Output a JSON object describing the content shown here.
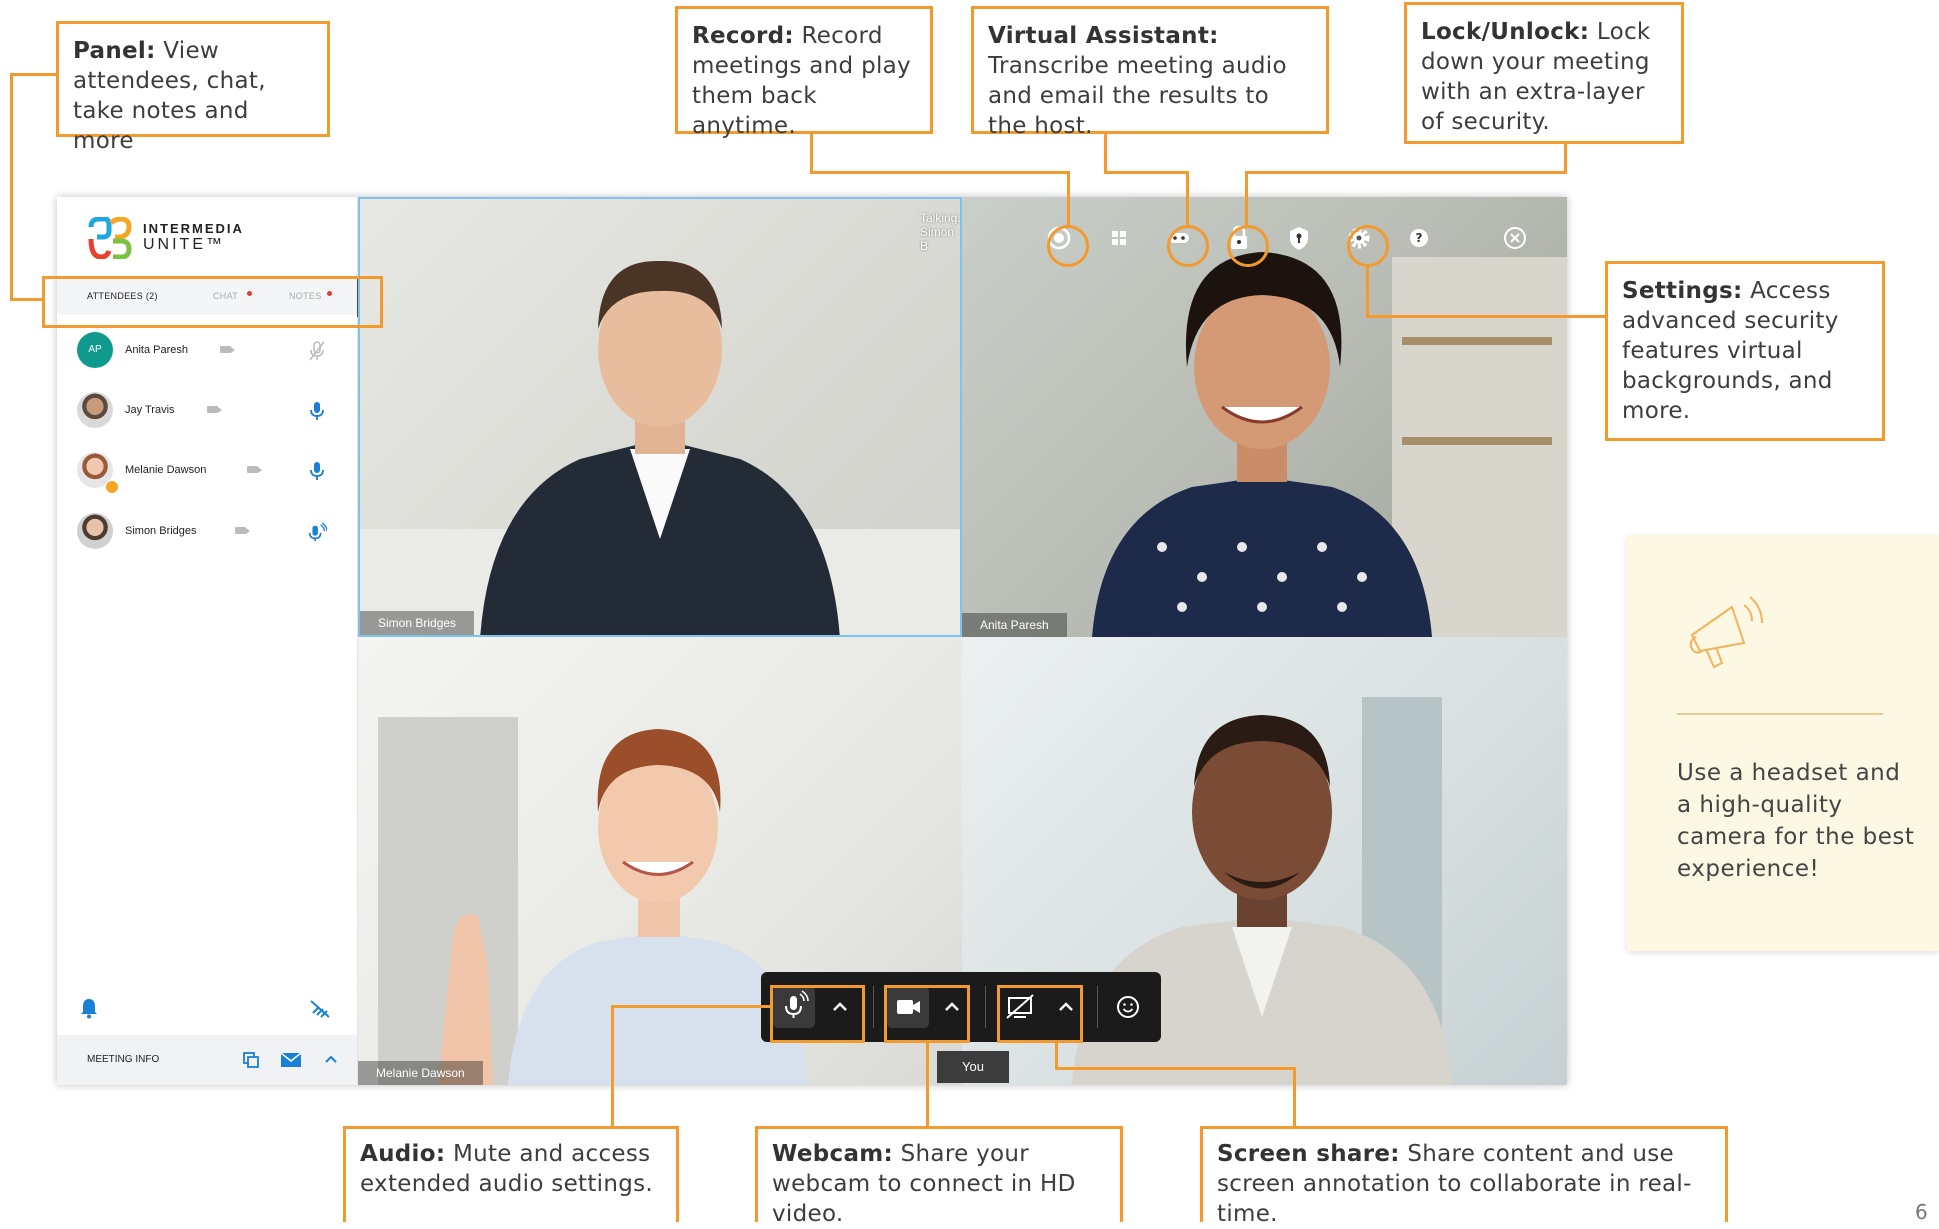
{
  "callouts": {
    "panel": {
      "title": "Panel:",
      "text": " View attendees, chat, take notes and more"
    },
    "record": {
      "title": "Record:",
      "text": " Record meetings and play them back anytime."
    },
    "assistant": {
      "title": "Virtual Assistant:",
      "text": " Transcribe meeting audio and email the results to the host."
    },
    "lock": {
      "title": "Lock/Unlock:",
      "text": " Lock down your meeting with an extra-layer of security."
    },
    "settings": {
      "title": "Settings:",
      "text": " Access advanced security features virtual backgrounds, and more."
    },
    "audio": {
      "title": "Audio:",
      "text": " Mute and access extended audio settings."
    },
    "webcam": {
      "title": "Webcam:",
      "text": " Share your webcam to connect in HD video."
    },
    "screenshare": {
      "title": "Screen share:",
      "text": " Share content and use screen annotation to collaborate in real-time."
    }
  },
  "app": {
    "logo_line1": "INTERMEDIA",
    "logo_line2": "UNITE™",
    "tabs": {
      "attendees": "ATTENDEES (2)",
      "chat": "CHAT",
      "notes": "NOTES"
    },
    "attendees": [
      {
        "initials": "AP",
        "name": "Anita Paresh"
      },
      {
        "name": "Jay Travis"
      },
      {
        "name": "Melanie Dawson"
      },
      {
        "name": "Simon Bridges"
      }
    ],
    "meeting_info": "MEETING INFO",
    "talking": "Talking: Simon B",
    "tiles": {
      "tl": "Simon Bridges",
      "tr": "Anita Paresh",
      "bl": "Melanie Dawson",
      "you": "You"
    }
  },
  "tip": {
    "text": "Use a headset and a high-quality camera for the best experience!"
  },
  "page_number": "6",
  "colors": {
    "accent": "#f39a2e",
    "mic_blue": "#1a7fd6",
    "tip_bg": "#fdf8e4"
  }
}
